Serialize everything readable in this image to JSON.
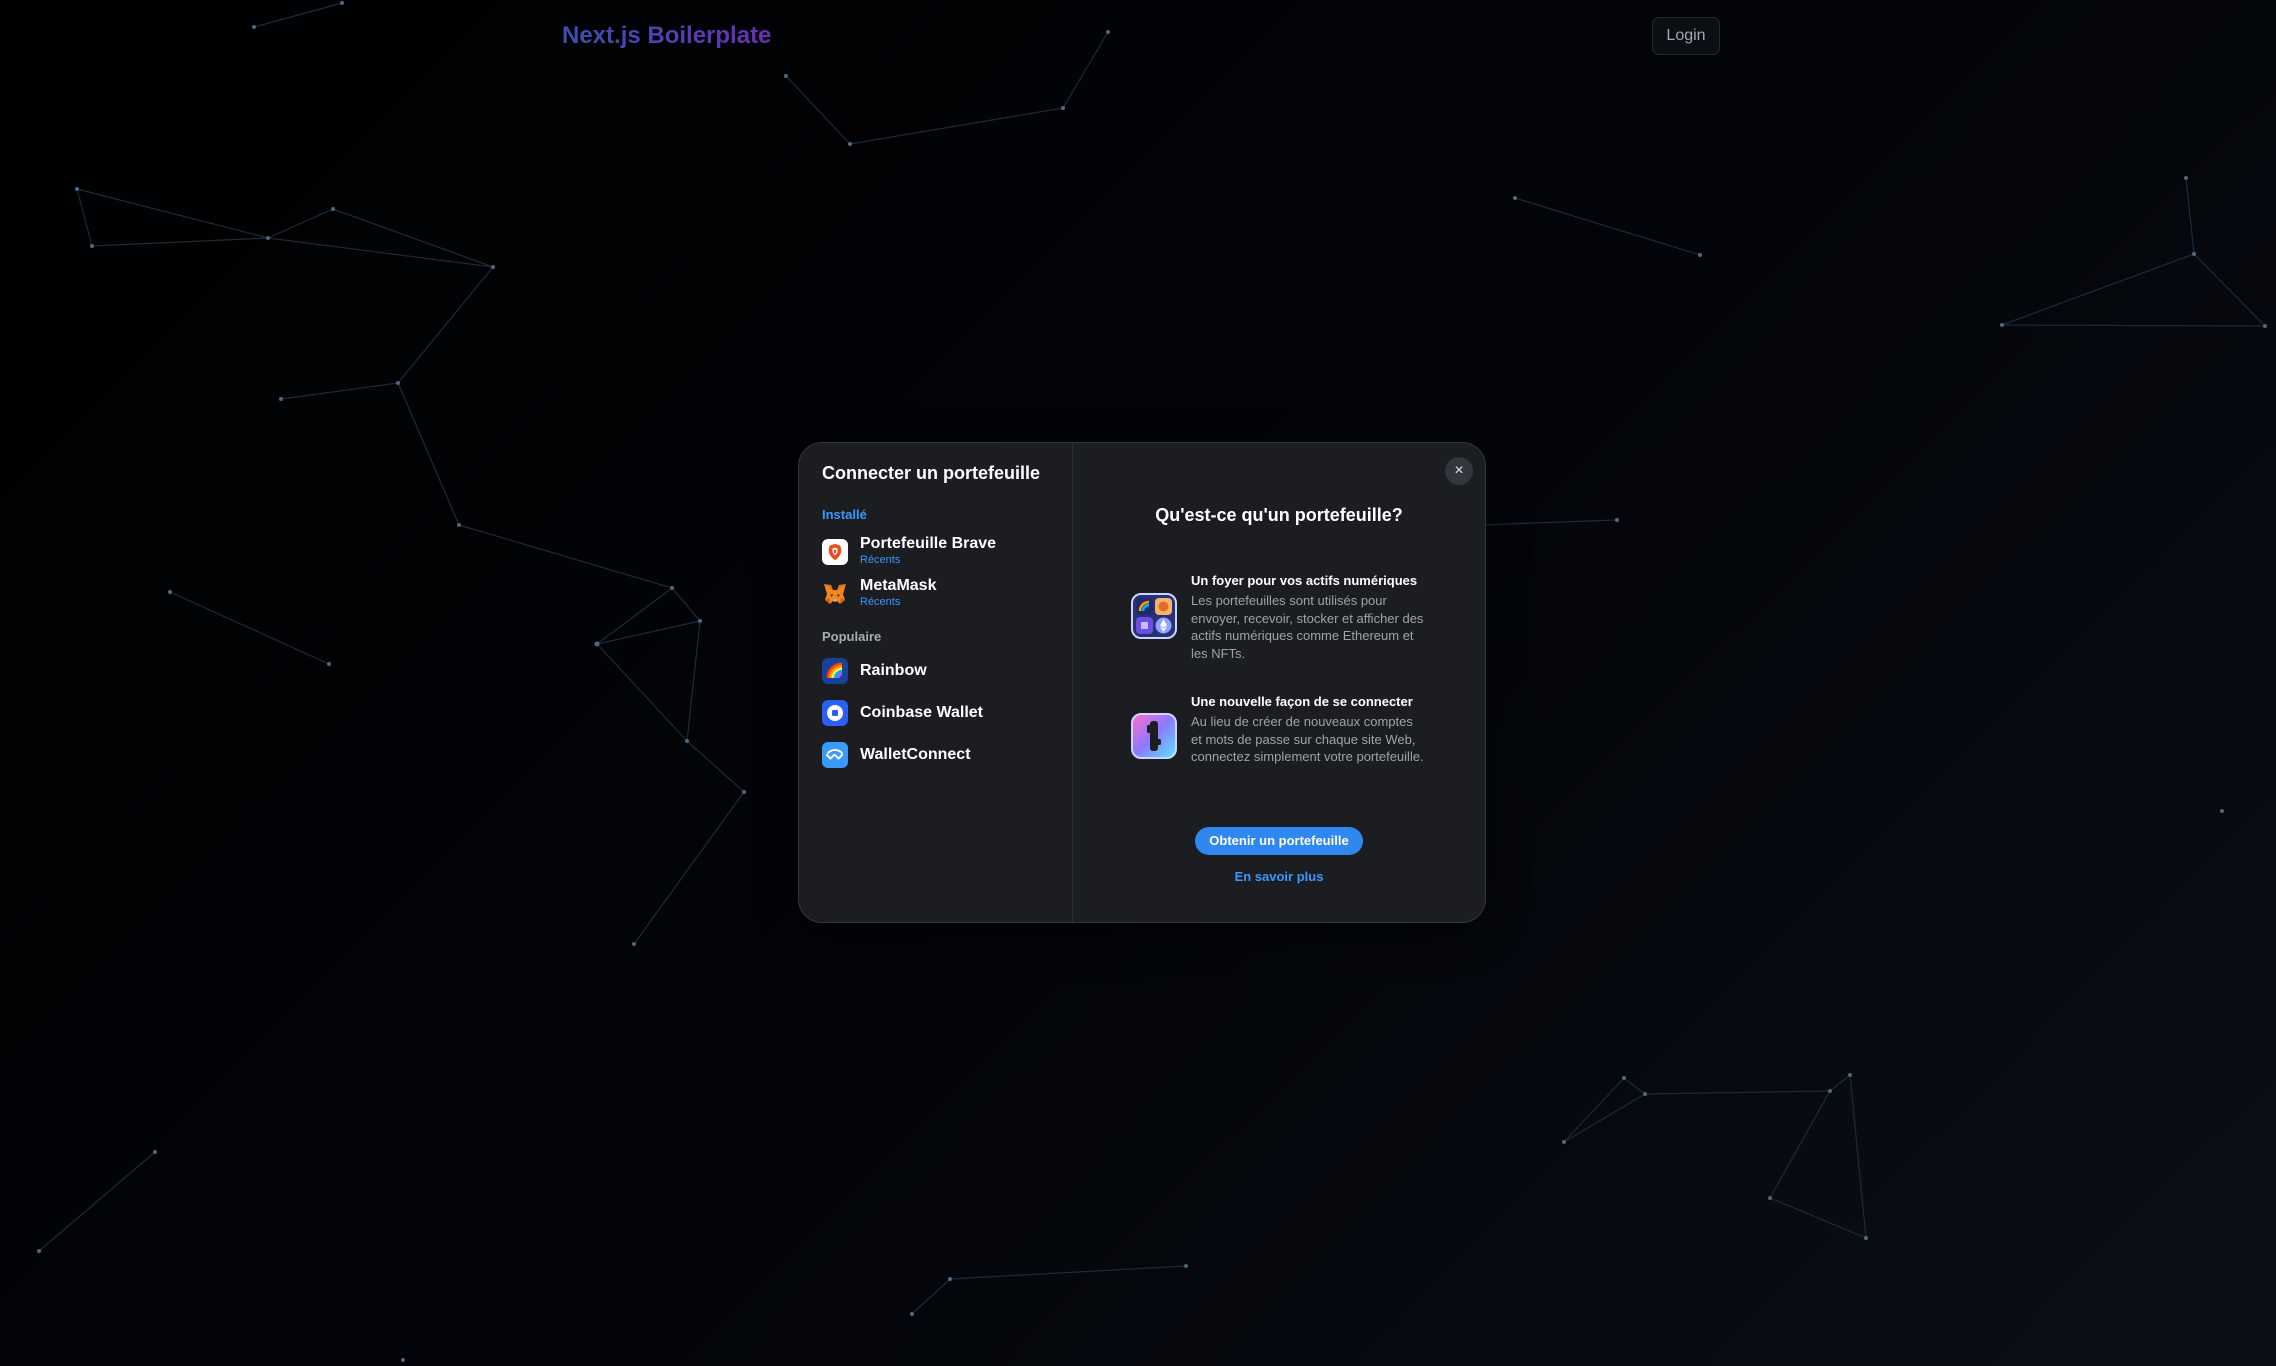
{
  "header": {
    "brand": "Next.js Boilerplate",
    "login_label": "Login"
  },
  "modal": {
    "title": "Connecter un portefeuille",
    "close_icon": "×",
    "installed_label": "Installé",
    "installed": [
      {
        "name": "Portefeuille Brave",
        "sub": "Récents",
        "icon": "brave-icon"
      },
      {
        "name": "MetaMask",
        "sub": "Récents",
        "icon": "metamask-icon"
      }
    ],
    "popular_label": "Populaire",
    "popular": [
      {
        "name": "Rainbow",
        "icon": "rainbow-icon"
      },
      {
        "name": "Coinbase Wallet",
        "icon": "coinbase-icon"
      },
      {
        "name": "WalletConnect",
        "icon": "walletconnect-icon"
      }
    ],
    "info": {
      "title": "Qu'est-ce qu'un portefeuille?",
      "features": [
        {
          "title": "Un foyer pour vos actifs numériques",
          "desc": "Les portefeuilles sont utilisés pour envoyer, recevoir, stocker et afficher des actifs numériques comme Ethereum et les NFTs.",
          "icon": "assets-grid-icon"
        },
        {
          "title": "Une nouvelle façon de se connecter",
          "desc": "Au lieu de créer de nouveaux comptes et mots de passe sur chaque site Web, connectez simplement votre portefeuille.",
          "icon": "key-login-icon"
        }
      ],
      "get_wallet_label": "Obtenir un portefeuille",
      "learn_more_label": "En savoir plus"
    }
  },
  "colors": {
    "accent": "#3898ff",
    "button": "#2f87f0",
    "modal_bg": "#1b1d21"
  }
}
